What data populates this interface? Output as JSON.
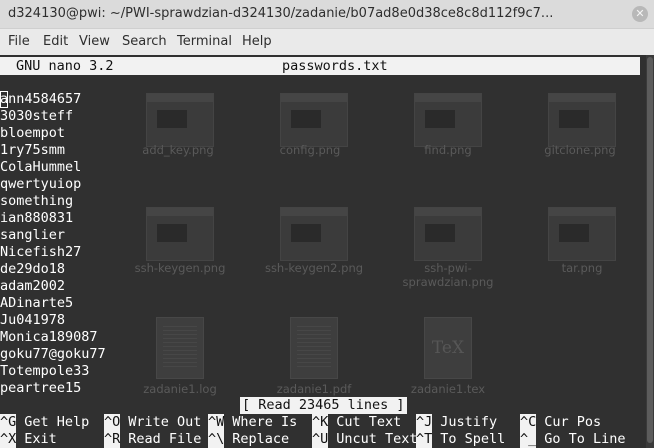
{
  "window": {
    "title": "d324130@pwi: ~/PWI-sprawdzian-d324130/zadanie/b07ad8e0d38ce8c8d112f9c7...",
    "close_glyph": "✕"
  },
  "menu": [
    "File",
    "Edit",
    "View",
    "Search",
    "Terminal",
    "Help"
  ],
  "nano": {
    "version": "GNU nano 3.2",
    "filename": "passwords.txt",
    "lines": [
      "ann4584657",
      "3030steff",
      "bloempot",
      "1ry75smm",
      "ColaHummel",
      "qwertyuiop",
      "something",
      "ian880831",
      "sanglier",
      "Nicefish27",
      "de29do18",
      "adam2002",
      "ADinarte5",
      "Ju041978",
      "Monica189087",
      "goku77@goku77",
      "Totempole33",
      "peartree15"
    ],
    "status": "[ Read 23465 lines ]",
    "shortcuts_row1": [
      {
        "key": "^G",
        "label": "Get Help"
      },
      {
        "key": "^O",
        "label": "Write Out"
      },
      {
        "key": "^W",
        "label": "Where Is"
      },
      {
        "key": "^K",
        "label": "Cut Text"
      },
      {
        "key": "^J",
        "label": "Justify"
      },
      {
        "key": "^C",
        "label": "Cur Pos"
      }
    ],
    "shortcuts_row2": [
      {
        "key": "^X",
        "label": "Exit"
      },
      {
        "key": "^R",
        "label": "Read File"
      },
      {
        "key": "^\\",
        "label": "Replace"
      },
      {
        "key": "^U",
        "label": "Uncut Text"
      },
      {
        "key": "^T",
        "label": "To Spell"
      },
      {
        "key": "^_",
        "label": "Go To Line"
      }
    ]
  },
  "desktop_files": [
    "add_key.png",
    "config.png",
    "find.png",
    "gitclone.png",
    "ssh-keygen.png",
    "ssh-keygen2.png",
    "ssh-pwi-\nsprawdzian.png",
    "tar.png",
    "zadanie1.log",
    "zadanie1.pdf",
    "zadanie1.tex"
  ],
  "colors": {
    "terminal_bg": "#303030",
    "terminal_fg": "#ffffff",
    "inverse_bg": "#f2f2f2",
    "titlebar_bg": "#dbdbdb",
    "menubar_bg": "#eaeaea"
  }
}
